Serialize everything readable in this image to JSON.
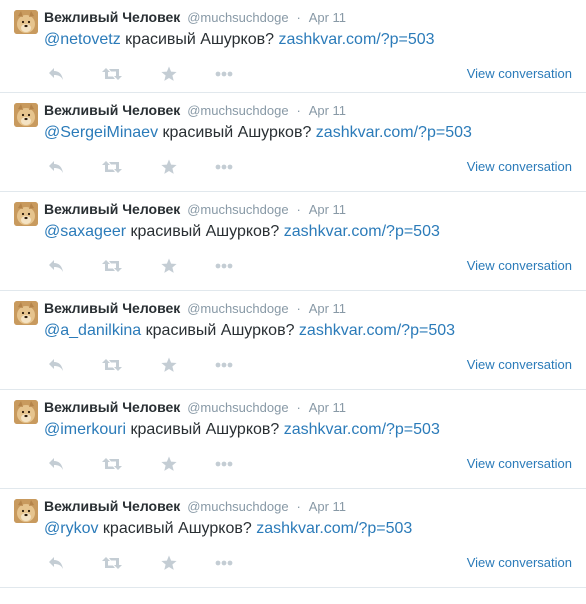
{
  "colors": {
    "link": "#2b7bb9",
    "muted": "#8899a6",
    "text": "#292f33",
    "icon": "#c4cdd4",
    "divider": "#e1e8ed"
  },
  "icons": [
    "reply-icon",
    "retweet-icon",
    "favorite-icon",
    "more-icon",
    "avatar-doge"
  ],
  "tweets": [
    {
      "name": "Вежливый Человек",
      "handle": "@muchsuchdoge",
      "sep": "·",
      "time": "Apr 11",
      "mention": "@netovetz",
      "body": " красивый Ашурков? ",
      "link": "zashkvar.com/?p=503",
      "view": "View conversation"
    },
    {
      "name": "Вежливый Человек",
      "handle": "@muchsuchdoge",
      "sep": "·",
      "time": "Apr 11",
      "mention": "@SergeiMinaev",
      "body": " красивый Ашурков? ",
      "link": "zashkvar.com/?p=503",
      "view": "View conversation"
    },
    {
      "name": "Вежливый Человек",
      "handle": "@muchsuchdoge",
      "sep": "·",
      "time": "Apr 11",
      "mention": "@saxageer",
      "body": " красивый Ашурков? ",
      "link": "zashkvar.com/?p=503",
      "view": "View conversation"
    },
    {
      "name": "Вежливый Человек",
      "handle": "@muchsuchdoge",
      "sep": "·",
      "time": "Apr 11",
      "mention": "@a_danilkina",
      "body": " красивый Ашурков? ",
      "link": "zashkvar.com/?p=503",
      "view": "View conversation"
    },
    {
      "name": "Вежливый Человек",
      "handle": "@muchsuchdoge",
      "sep": "·",
      "time": "Apr 11",
      "mention": "@imerkouri",
      "body": "  красивый Ашурков? ",
      "link": "zashkvar.com/?p=503",
      "view": "View conversation"
    },
    {
      "name": "Вежливый Человек",
      "handle": "@muchsuchdoge",
      "sep": "·",
      "time": "Apr 11",
      "mention": "@rykov",
      "body": " красивый Ашурков? ",
      "link": "zashkvar.com/?p=503",
      "view": "View conversation"
    }
  ]
}
